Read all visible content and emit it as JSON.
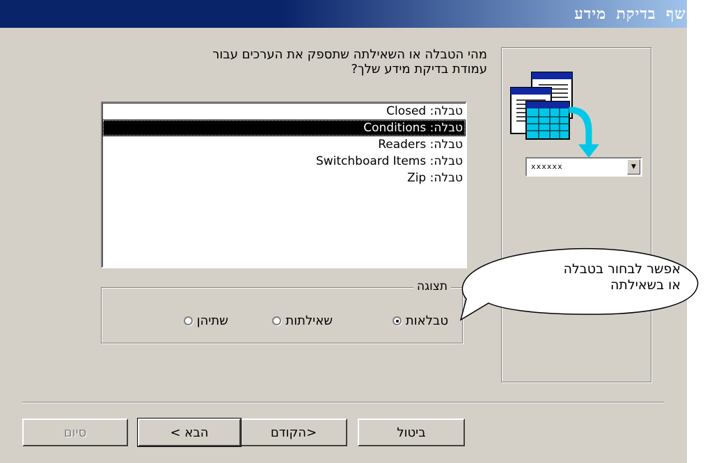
{
  "window": {
    "title": "אשף בדיקת מידע"
  },
  "prompt": {
    "text": "מהי הטבלה או השאילתה שתספק את הערכים עבור\nעמודת בדיקת מידע שלך?"
  },
  "listbox": {
    "items": [
      {
        "label": "טבלה: Closed"
      },
      {
        "label": "טבלה: Conditions"
      },
      {
        "label": "טבלה: Readers"
      },
      {
        "label": "טבלה: Switchboard Items"
      },
      {
        "label": "טבלה: Zip"
      }
    ],
    "selected_index": 1
  },
  "view_group": {
    "label": "תצוגה",
    "options": [
      {
        "label": "טבלאות",
        "checked": true
      },
      {
        "label": "שאילתות",
        "checked": false
      },
      {
        "label": "שתיהן",
        "checked": false
      }
    ]
  },
  "preview": {
    "combo_value": "xxxxxx"
  },
  "callout": {
    "text": "אפשר לבחור בטבלה\nאו בשאילתה"
  },
  "buttons": {
    "cancel": "ביטול",
    "back": "<הקודם",
    "next": "הבא >",
    "finish": "סיום"
  },
  "colors": {
    "title_bar": "#0a246a",
    "face": "#d4d0c8",
    "selection": "#000000",
    "icon_cyan": "#00c8e8"
  }
}
